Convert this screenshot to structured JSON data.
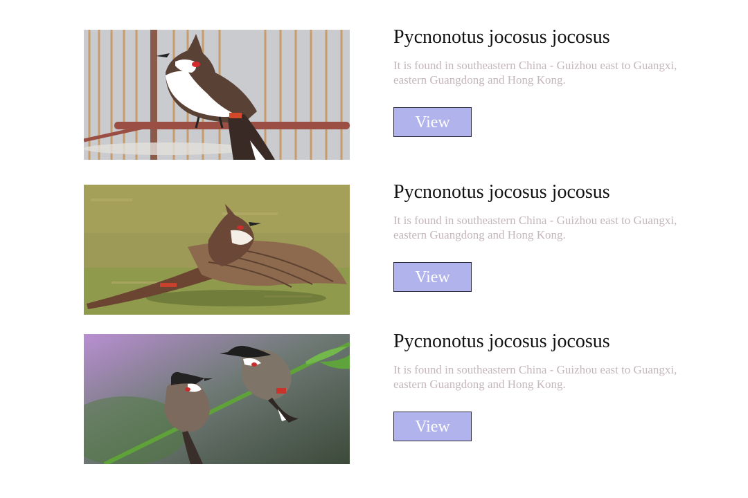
{
  "items": [
    {
      "title": "Pycnonotus jocosus jocosus",
      "description": "It is found in southeastern China - Guizhou east to Guangxi, eastern Guangdong and Hong Kong.",
      "button_label": "View",
      "image_icon": "bulbul-perched-in-cage-photo"
    },
    {
      "title": "Pycnonotus jocosus jocosus",
      "description": "It is found in southeastern China - Guizhou east to Guangxi, eastern Guangdong and Hong Kong.",
      "button_label": "View",
      "image_icon": "bulbul-wings-spread-on-grass-photo"
    },
    {
      "title": "Pycnonotus jocosus jocosus",
      "description": "It is found in southeastern China - Guizhou east to Guangxi, eastern Guangdong and Hong Kong.",
      "button_label": "View",
      "image_icon": "two-bulbuls-on-branch-photo"
    }
  ],
  "colors": {
    "button_bg": "#b1b3ec",
    "title_text": "#111111",
    "description_text": "#c4b6bc"
  }
}
